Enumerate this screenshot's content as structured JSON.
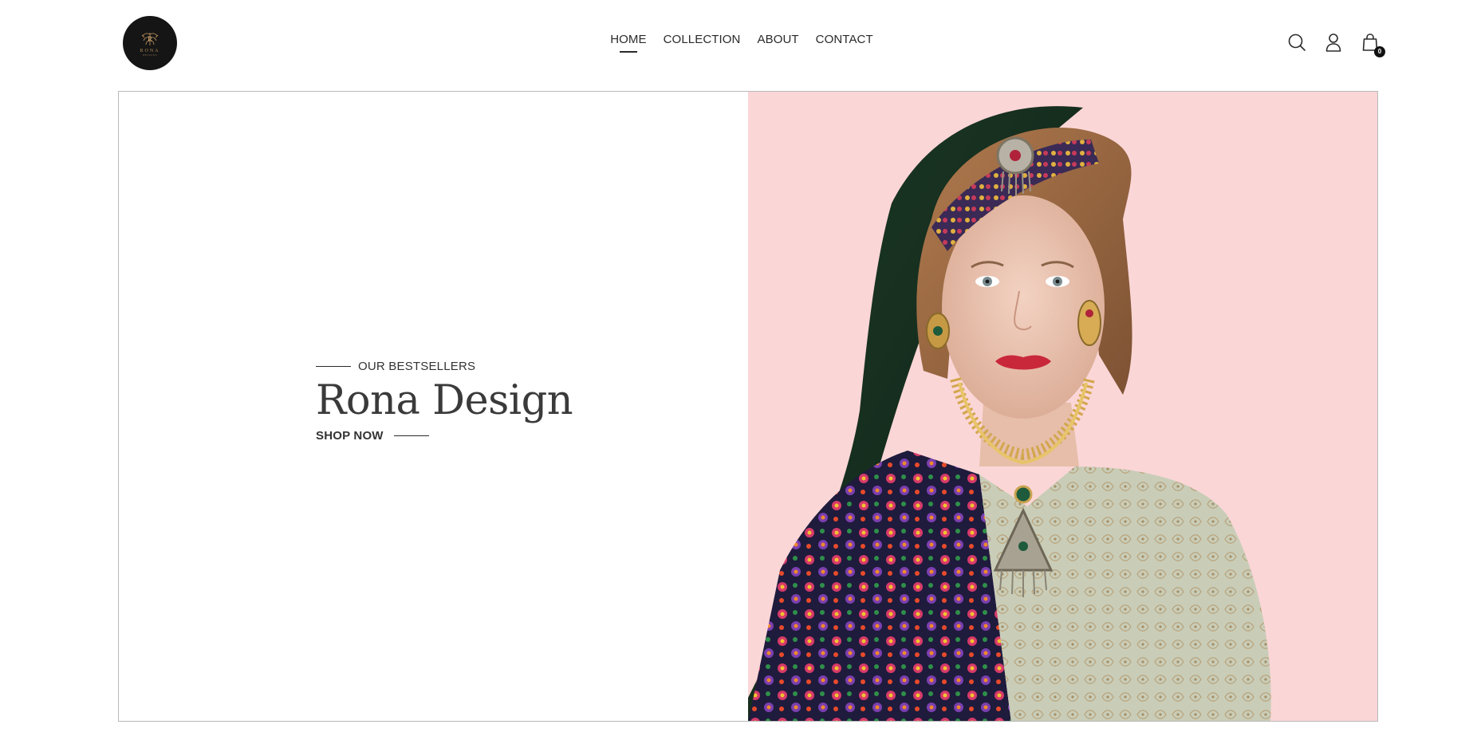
{
  "brand": {
    "logo_text": "RONA",
    "logo_subtext": "DESIGNS"
  },
  "nav": {
    "items": [
      {
        "label": "HOME",
        "active": true
      },
      {
        "label": "COLLECTION",
        "active": false
      },
      {
        "label": "ABOUT",
        "active": false
      },
      {
        "label": "CONTACT",
        "active": false
      }
    ]
  },
  "header_icons": {
    "search": "search-icon",
    "account": "user-icon",
    "cart": "shopping-bag-icon",
    "cart_count": "0"
  },
  "hero": {
    "eyebrow": "OUR BESTSELLERS",
    "title": "Rona Design",
    "cta": "SHOP NOW",
    "image_background": "#fbd6d7"
  },
  "colors": {
    "text_primary": "#2b2b2b",
    "logo_bg": "#151515",
    "logo_gold": "#b08a5a",
    "hero_right_bg": "#fbd6d7"
  }
}
